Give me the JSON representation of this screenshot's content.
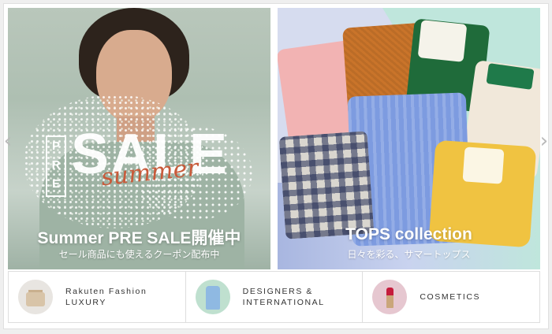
{
  "banners": [
    {
      "title": "Summer PRE SALE開催中",
      "subtitle": "セール商品にも使えるクーポン配布中",
      "art": {
        "pre": "PRE",
        "sale": "SALE",
        "script": "summer"
      }
    },
    {
      "title": "TOPS collection",
      "subtitle": "日々を彩る、サマートップス"
    }
  ],
  "carousel": {
    "prev_icon": "‹",
    "next_icon": "›"
  },
  "categories": [
    {
      "label": "Rakuten Fashion\nLUXURY",
      "icon": "luxury-bag-thumbnail"
    },
    {
      "label": "DESIGNERS &\nINTERNATIONAL",
      "icon": "designer-shirt-thumbnail"
    },
    {
      "label": "COSMETICS",
      "icon": "lipstick-thumbnail"
    }
  ]
}
